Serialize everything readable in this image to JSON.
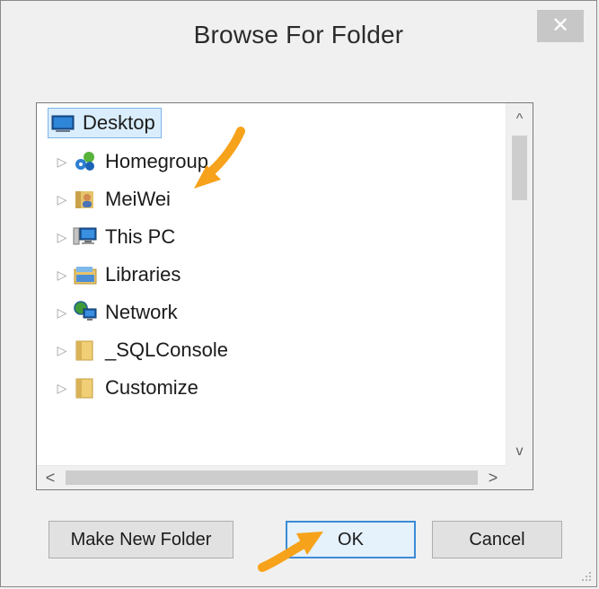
{
  "dialog": {
    "title": "Browse For Folder",
    "close_label": "✕"
  },
  "tree": {
    "items": [
      {
        "label": "Desktop",
        "icon": "desktop-icon",
        "selected": true
      },
      {
        "label": "Homegroup",
        "icon": "homegroup-icon"
      },
      {
        "label": "MeiWei",
        "icon": "user-folder-icon"
      },
      {
        "label": "This PC",
        "icon": "computer-icon"
      },
      {
        "label": "Libraries",
        "icon": "libraries-icon"
      },
      {
        "label": "Network",
        "icon": "network-icon"
      },
      {
        "label": "_SQLConsole",
        "icon": "folder-icon"
      },
      {
        "label": "Customize",
        "icon": "folder-icon"
      }
    ],
    "scrollbar": {
      "up": "^",
      "down": "v",
      "left": "<",
      "right": ">"
    }
  },
  "buttons": {
    "make_new_folder": "Make New Folder",
    "ok": "OK",
    "cancel": "Cancel"
  },
  "colors": {
    "selection_fill": "#d9edfc",
    "selection_border": "#7eb4ea",
    "default_button_border": "#3c8bd6",
    "annotation_arrow": "#f7a21b"
  }
}
